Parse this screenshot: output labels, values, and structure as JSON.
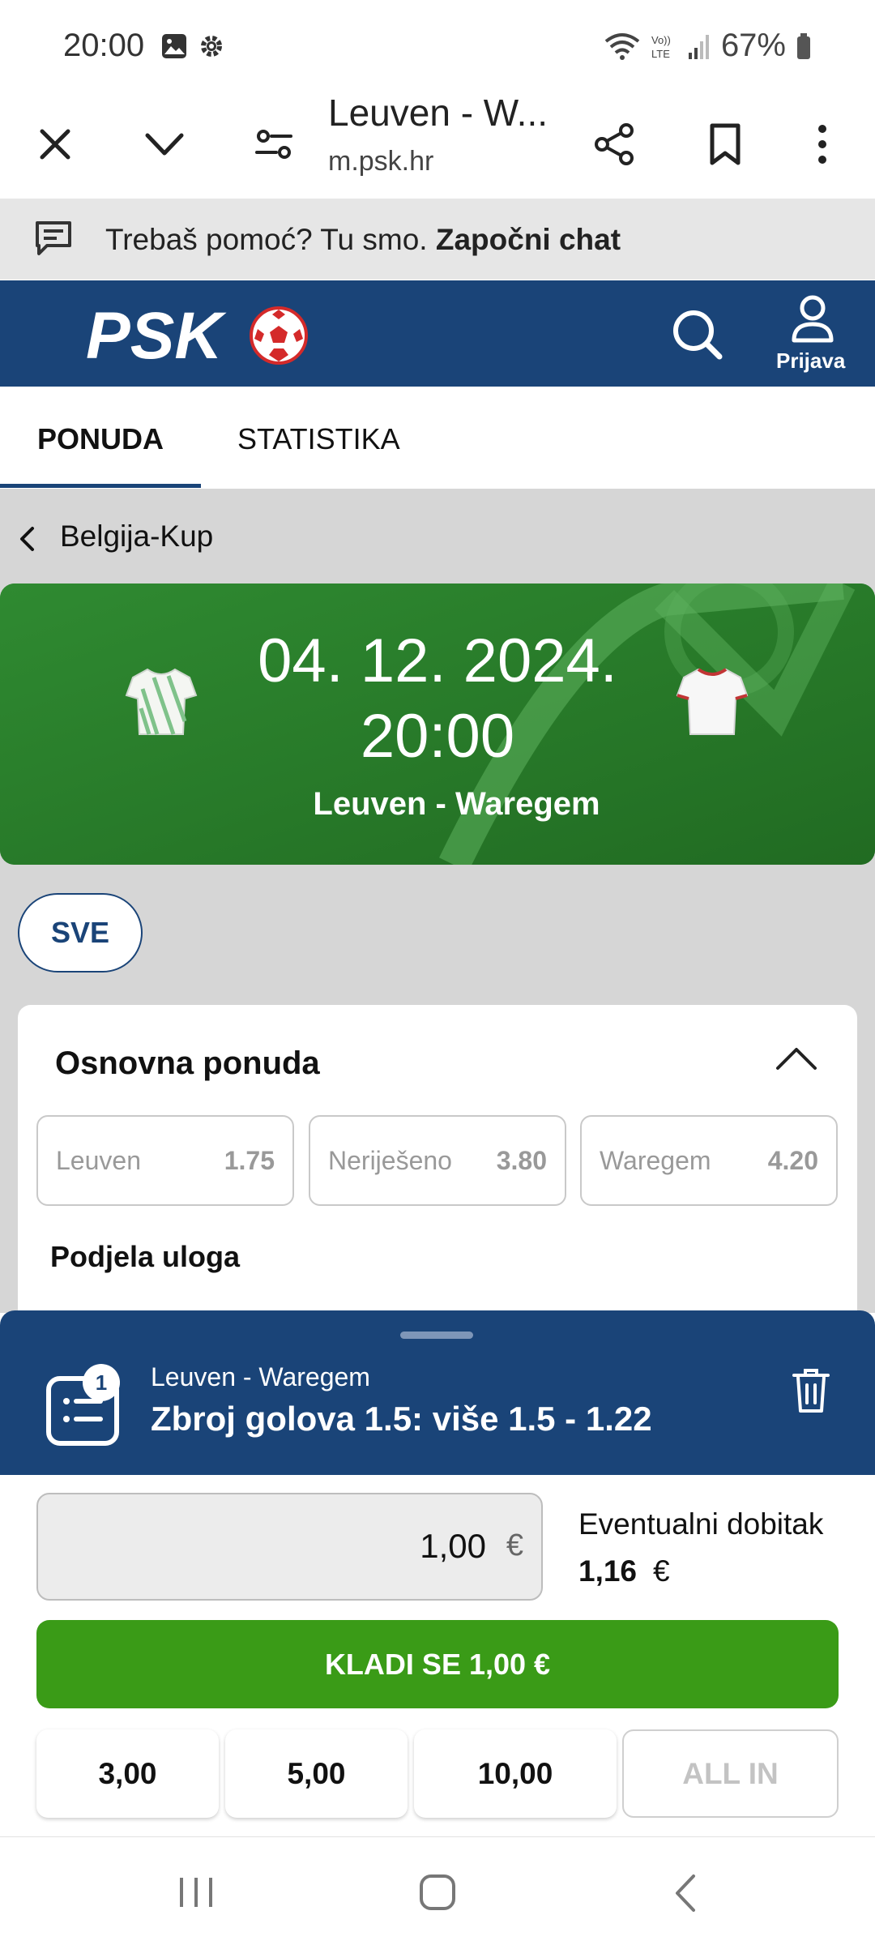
{
  "status_bar": {
    "time": "20:00",
    "battery": "67%"
  },
  "browser": {
    "page_title": "Leuven - W...",
    "url": "m.psk.hr"
  },
  "help_bar": {
    "text": "Trebaš pomoć? Tu smo.",
    "link": "Započni chat"
  },
  "header": {
    "logo": "PSK",
    "login_label": "Prijava"
  },
  "tabs": [
    {
      "label": "PONUDA",
      "active": true
    },
    {
      "label": "STATISTIKA",
      "active": false
    }
  ],
  "breadcrumb": "Belgija-Kup",
  "match": {
    "date": "04. 12. 2024.",
    "time": "20:00",
    "teams": "Leuven - Waregem"
  },
  "filter": {
    "label": "SVE"
  },
  "market": {
    "title": "Osnovna ponuda",
    "odds": [
      {
        "label": "Leuven",
        "value": "1.75"
      },
      {
        "label": "Neriješeno",
        "value": "3.80"
      },
      {
        "label": "Waregem",
        "value": "4.20"
      }
    ],
    "next_section": "Podjela uloga"
  },
  "bet_slip": {
    "count": "1",
    "match": "Leuven - Waregem",
    "selection": "Zbroj golova 1.5: više 1.5 - 1.22",
    "stake": "1,00",
    "currency": "€",
    "potential_win_label": "Eventualni dobitak",
    "potential_win": "1,16",
    "place_bet_label": "KLADI SE 1,00 €",
    "quick_stakes": [
      "3,00",
      "5,00",
      "10,00"
    ],
    "all_in_label": "ALL IN"
  },
  "colors": {
    "brand_blue": "#1a4478",
    "bet_green": "#3a9b17",
    "pitch_green": "#2c7d2c"
  }
}
